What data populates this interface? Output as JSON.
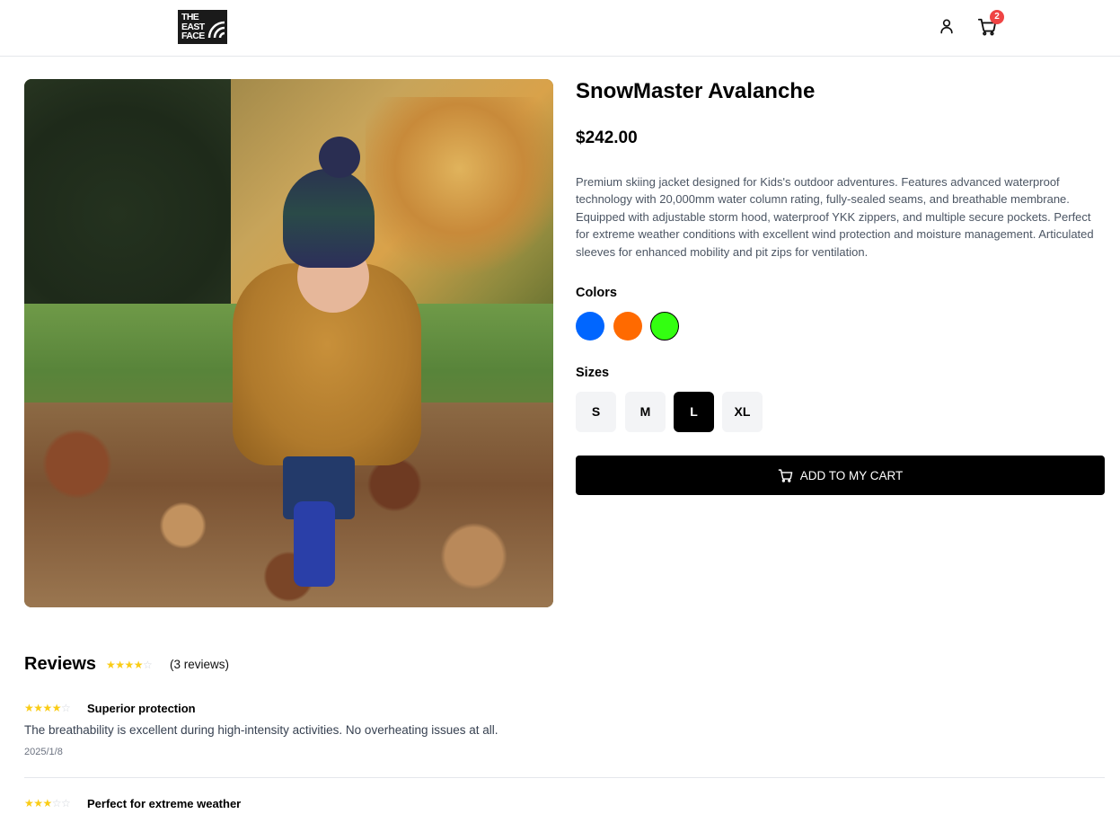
{
  "header": {
    "logo_text": [
      "THE",
      "EAST",
      "FACE"
    ],
    "cart_count": "2",
    "icons": [
      "user-icon",
      "cart-icon"
    ]
  },
  "product": {
    "title": "SnowMaster Avalanche",
    "price": "$242.00",
    "description": "Premium skiing jacket designed for Kids's outdoor adventures. Features advanced waterproof technology with 20,000mm water column rating, fully-sealed seams, and breathable membrane. Equipped with adjustable storm hood, waterproof YKK zippers, and multiple secure pockets. Perfect for extreme weather conditions with excellent wind protection and moisture management. Articulated sleeves for enhanced mobility and pit zips for ventilation.",
    "colors_label": "Colors",
    "colors": [
      {
        "hex": "#0066ff",
        "selected": false
      },
      {
        "hex": "#ff6a00",
        "selected": false
      },
      {
        "hex": "#33ff11",
        "selected": true
      }
    ],
    "sizes_label": "Sizes",
    "sizes": [
      {
        "label": "S",
        "selected": false
      },
      {
        "label": "M",
        "selected": false
      },
      {
        "label": "L",
        "selected": true
      },
      {
        "label": "XL",
        "selected": false
      }
    ],
    "add_to_cart_label": "ADD TO MY CART"
  },
  "reviews": {
    "title": "Reviews",
    "average_rating": 4,
    "count_text": "(3 reviews)",
    "items": [
      {
        "rating": 4,
        "title": "Superior protection",
        "text": "The breathability is excellent during high-intensity activities. No overheating issues at all.",
        "date": "2025/1/8"
      },
      {
        "rating": 3,
        "title": "Perfect for extreme weather",
        "text": "",
        "date": ""
      }
    ]
  },
  "colors": {
    "star_on": "#facc15",
    "star_off": "#d1d5db",
    "badge": "#ef4444",
    "primary": "#000000"
  }
}
